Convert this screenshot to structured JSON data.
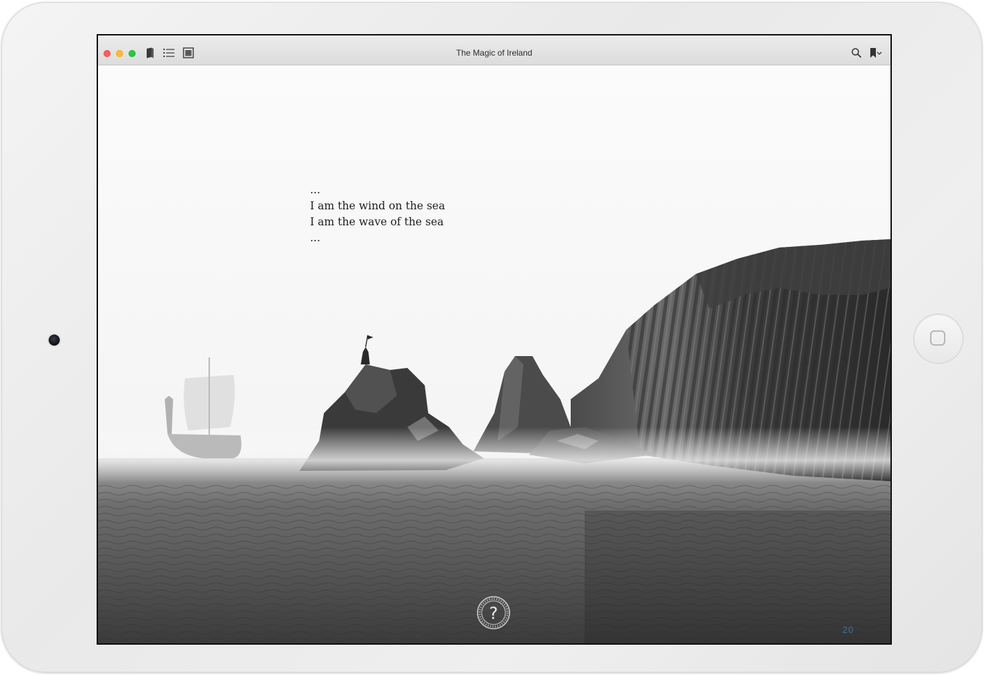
{
  "window": {
    "title": "The Magic of Ireland"
  },
  "toolbar": {
    "left_icons": [
      "book-icon",
      "list-icon",
      "page-view-icon"
    ],
    "right_icons": [
      "search-icon",
      "bookmark-icon",
      "chevron-down-icon"
    ]
  },
  "page": {
    "poem_lines": [
      "...",
      "I am the wind on the sea",
      "I am the wave of the sea",
      "..."
    ],
    "help_symbol": "?",
    "page_number": "20"
  },
  "colors": {
    "page_number": "#3f6f9a",
    "traffic_red": "#fc5f57",
    "traffic_yellow": "#fdbc2e",
    "traffic_green": "#28c840"
  }
}
